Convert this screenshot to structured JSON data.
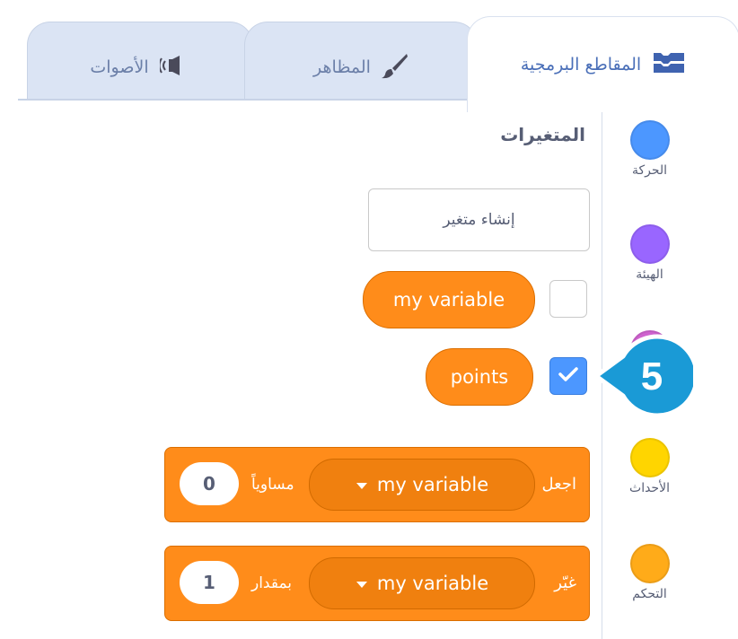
{
  "tabs": [
    {
      "id": "code",
      "label": "المقاطع البرمجية",
      "icon": "code-blocks-icon",
      "active": true
    },
    {
      "id": "costumes",
      "label": "المظاهر",
      "icon": "paintbrush-icon",
      "active": false
    },
    {
      "id": "sounds",
      "label": "الأصوات",
      "icon": "speaker-icon",
      "active": false
    }
  ],
  "categories": [
    {
      "label": "الحركة",
      "color": "#4c97ff"
    },
    {
      "label": "الهيئة",
      "color": "#9966ff"
    },
    {
      "label": "",
      "color": "#cf63cf"
    },
    {
      "label": "الأحداث",
      "color": "#ffd500"
    },
    {
      "label": "التحكم",
      "color": "#ffab19"
    }
  ],
  "palette": {
    "section_title": "المتغيرات",
    "make_variable_button": "إنشاء متغير",
    "variables": [
      {
        "name": "my variable",
        "checked": false
      },
      {
        "name": "points",
        "checked": true
      }
    ],
    "blocks": [
      {
        "verb": "اجعل",
        "variable": "my variable",
        "preposition": "مساوياً",
        "value": "0"
      },
      {
        "verb": "غيّر",
        "variable": "my variable",
        "preposition": "بمقدار",
        "value": "1"
      }
    ]
  },
  "callout": {
    "step_number": "5",
    "color": "#1a9ad6"
  },
  "colors": {
    "variables_orange": "#ff8c1a",
    "checkbox_blue": "#4c97ff",
    "tab_inactive": "#dbe4f4"
  }
}
